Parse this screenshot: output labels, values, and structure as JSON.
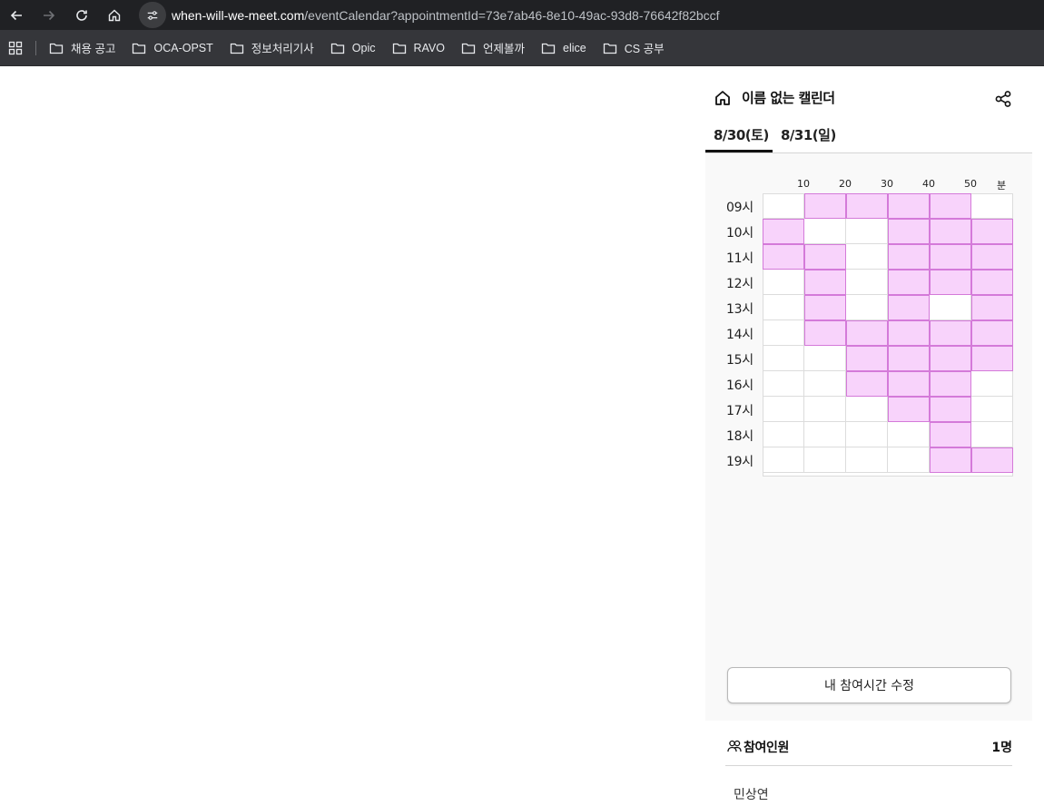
{
  "browser": {
    "url_host": "when-will-we-meet.com",
    "url_path": "/eventCalendar?appointmentId=73e7ab46-8e10-49ac-93d8-76642f82bccf",
    "bookmarks": [
      "채용 공고",
      "OCA-OPST",
      "정보처리기사",
      "Opic",
      "RAVO",
      "언제볼까",
      "elice",
      "CS 공부"
    ]
  },
  "calendar": {
    "title": "이름 없는 캘린더",
    "tabs": [
      "8/30(토)",
      "8/31(일)"
    ],
    "active_tab": 0,
    "minute_labels": [
      "10",
      "20",
      "30",
      "40",
      "50",
      "분"
    ],
    "hours": [
      "09시",
      "10시",
      "11시",
      "12시",
      "13시",
      "14시",
      "15시",
      "16시",
      "17시",
      "18시",
      "19시"
    ],
    "availability": [
      [
        0,
        1,
        1,
        1,
        1,
        0
      ],
      [
        1,
        0,
        0,
        1,
        1,
        1
      ],
      [
        1,
        1,
        0,
        1,
        1,
        1
      ],
      [
        0,
        1,
        0,
        1,
        1,
        1
      ],
      [
        0,
        1,
        0,
        1,
        0,
        1
      ],
      [
        0,
        1,
        1,
        1,
        1,
        1
      ],
      [
        0,
        0,
        1,
        1,
        1,
        1
      ],
      [
        0,
        0,
        1,
        1,
        1,
        0
      ],
      [
        0,
        0,
        0,
        1,
        1,
        0
      ],
      [
        0,
        0,
        0,
        0,
        1,
        0
      ],
      [
        0,
        0,
        0,
        0,
        1,
        1
      ]
    ],
    "available_color": "#f8d3fb",
    "edit_button": "내 참여시간 수정"
  },
  "participants": {
    "label": "참여인원",
    "count": "1명",
    "members": [
      "민상연"
    ]
  }
}
